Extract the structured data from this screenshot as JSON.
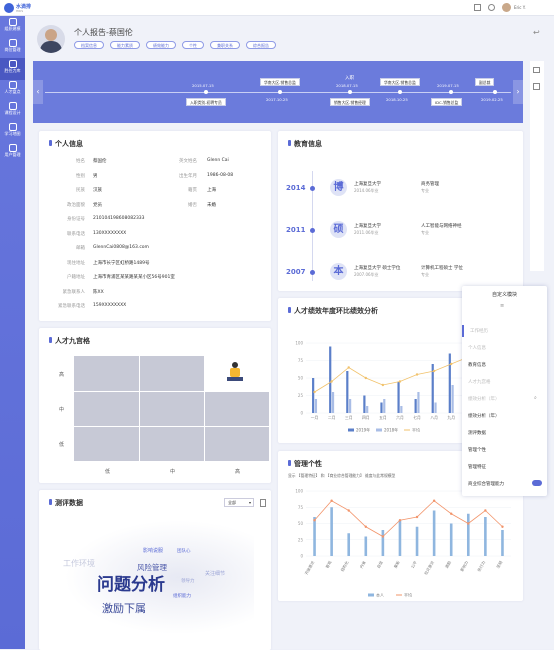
{
  "app": {
    "logo_text": "水滴排",
    "logo_sub": "HRIS",
    "user_name": "Eric Y."
  },
  "sidebar": [
    {
      "label": "组织建模"
    },
    {
      "label": "岗位管理"
    },
    {
      "label": "胜任力库"
    },
    {
      "label": "人才盘点"
    },
    {
      "label": "课程设计"
    },
    {
      "label": "学习地图"
    },
    {
      "label": "用户管理"
    }
  ],
  "profile": {
    "title": "个人报告-蔡国伦",
    "tags": [
      "档案信息",
      "能力素质",
      "绩效能力",
      "个性",
      "兼职关系",
      "综合报告"
    ]
  },
  "timeline": {
    "items": [
      {
        "date": "2015.07.15",
        "box": "入职类别-初聘专员",
        "pos": "below"
      },
      {
        "date": "2017.10.25",
        "box": "华南大区-销售总监",
        "pos": "above"
      },
      {
        "date": "2018.07.15",
        "box": "入职",
        "box2": "销售大区-销售经理",
        "pos": "both"
      },
      {
        "date": "2018.10.25",
        "box": "华南大区-销售总监",
        "pos": "above"
      },
      {
        "date": "2019.07.15",
        "box": "IDC-销售总监",
        "pos": "below"
      },
      {
        "date": "2019.02.25",
        "box": "副总裁",
        "pos": "above"
      }
    ]
  },
  "personal": {
    "title": "个人信息",
    "fields": [
      {
        "label": "姓名",
        "value": "蔡国伦",
        "label2": "英文姓名",
        "value2": "Glenn Cai"
      },
      {
        "label": "性别",
        "value": "男",
        "label2": "出生年月",
        "value2": "1986-08-08"
      },
      {
        "label": "民族",
        "value": "汉族",
        "label2": "籍贯",
        "value2": "上海"
      },
      {
        "label": "政治面貌",
        "value": "党员",
        "label2": "婚否",
        "value2": "未婚"
      },
      {
        "label": "身份证号",
        "value": "210104198608082333"
      },
      {
        "label": "联系电话",
        "value": "130XXXXXXXX"
      },
      {
        "label": "邮箱",
        "value": "GlennCai0808@163.com"
      },
      {
        "label": "现住地址",
        "value": "上海市长宁区虹桥路1489号"
      },
      {
        "label": "户籍地址",
        "value": "上海市青浦区某某路某某小区56号901室"
      },
      {
        "label": "紧急联系人",
        "value": "陈XX"
      },
      {
        "label": "紧急联系电话",
        "value": "159XXXXXXXX"
      }
    ]
  },
  "education": {
    "title": "教育信息",
    "items": [
      {
        "year": "2014",
        "degree_icon": "博",
        "school": "上海复旦大学",
        "date": "2014.06毕业",
        "major": "商务管理",
        "major_sub": "专业"
      },
      {
        "year": "2011",
        "degree_icon": "硕",
        "school": "上海复旦大学",
        "date": "2011.06毕业",
        "major": "人工智能与网络神经",
        "major_sub": "专业"
      },
      {
        "year": "2007",
        "degree_icon": "本",
        "school": "上海复旦大学 硕士学位",
        "date": "2007.06毕业",
        "major": "计算机工程硕士 学位",
        "major_sub": "专业"
      }
    ]
  },
  "nine_grid": {
    "title": "人才九宫格",
    "ylabels": [
      "高",
      "中",
      "低"
    ],
    "xlabels": [
      "低",
      "中",
      "高"
    ]
  },
  "review": {
    "title": "测评数据",
    "select": "全部",
    "words": [
      "问题分析",
      "激励下属",
      "风险管理",
      "工作环境",
      "影响说服",
      "团队心",
      "关注细节",
      "组织能力",
      "领导力"
    ]
  },
  "perf_chart": {
    "title": "人才绩效年度环比绩效分析",
    "legend": [
      "2019年",
      "2018年",
      "平均"
    ]
  },
  "mgmt_chart": {
    "title": "管理个性",
    "filter": "显示 【管理特征】 和 【商业综合管理能力】 维度与此常规模型",
    "legend": [
      "本人",
      "平均"
    ]
  },
  "custom_menu": {
    "title": "自定义模块",
    "items": [
      {
        "label": "工作经历",
        "state": "dim"
      },
      {
        "label": "个人信息",
        "state": "dim"
      },
      {
        "label": "教育信息",
        "state": "on"
      },
      {
        "label": "人才九宫格",
        "state": "dim"
      },
      {
        "label": "绩效分析（年）",
        "state": "dim"
      },
      {
        "label": "绩效分析（年）",
        "state": "on"
      },
      {
        "label": "测评数据",
        "state": "on"
      },
      {
        "label": "管理个性",
        "state": "on"
      },
      {
        "label": "管理特征",
        "state": "on"
      },
      {
        "label": "商业综合管理能力",
        "state": "on"
      }
    ]
  },
  "chart_data": [
    {
      "type": "bar",
      "title": "人才绩效年度环比绩效分析",
      "categories": [
        "一月",
        "二月",
        "三月",
        "四月",
        "五月",
        "六月",
        "七月",
        "八月",
        "九月",
        "十月",
        "十一月",
        "十二月"
      ],
      "series": [
        {
          "name": "2019年",
          "values": [
            50,
            95,
            60,
            25,
            15,
            45,
            20,
            70,
            85,
            75,
            60,
            80
          ]
        },
        {
          "name": "2018年",
          "values": [
            20,
            30,
            20,
            10,
            20,
            10,
            30,
            15,
            40,
            10,
            20,
            15
          ]
        },
        {
          "name": "平均",
          "values": [
            30,
            45,
            65,
            50,
            40,
            45,
            55,
            60,
            70,
            80,
            70,
            60
          ]
        }
      ],
      "ylim": [
        0,
        100
      ],
      "yticks": [
        0,
        25,
        50,
        75,
        100
      ]
    },
    {
      "type": "bar",
      "title": "管理个性",
      "categories": [
        "开放意识",
        "客观",
        "结构化",
        "内省",
        "自信",
        "果断",
        "公平",
        "社交意识",
        "激励",
        "影响力",
        "执行力",
        "坚韧"
      ],
      "series": [
        {
          "name": "本人",
          "values": [
            60,
            75,
            35,
            30,
            40,
            55,
            45,
            70,
            50,
            65,
            60,
            40
          ]
        },
        {
          "name": "平均",
          "values": [
            55,
            85,
            70,
            45,
            30,
            55,
            60,
            85,
            65,
            50,
            70,
            45
          ]
        }
      ],
      "ylim": [
        0,
        100
      ],
      "yticks": [
        0,
        25,
        50,
        75,
        100
      ]
    }
  ]
}
